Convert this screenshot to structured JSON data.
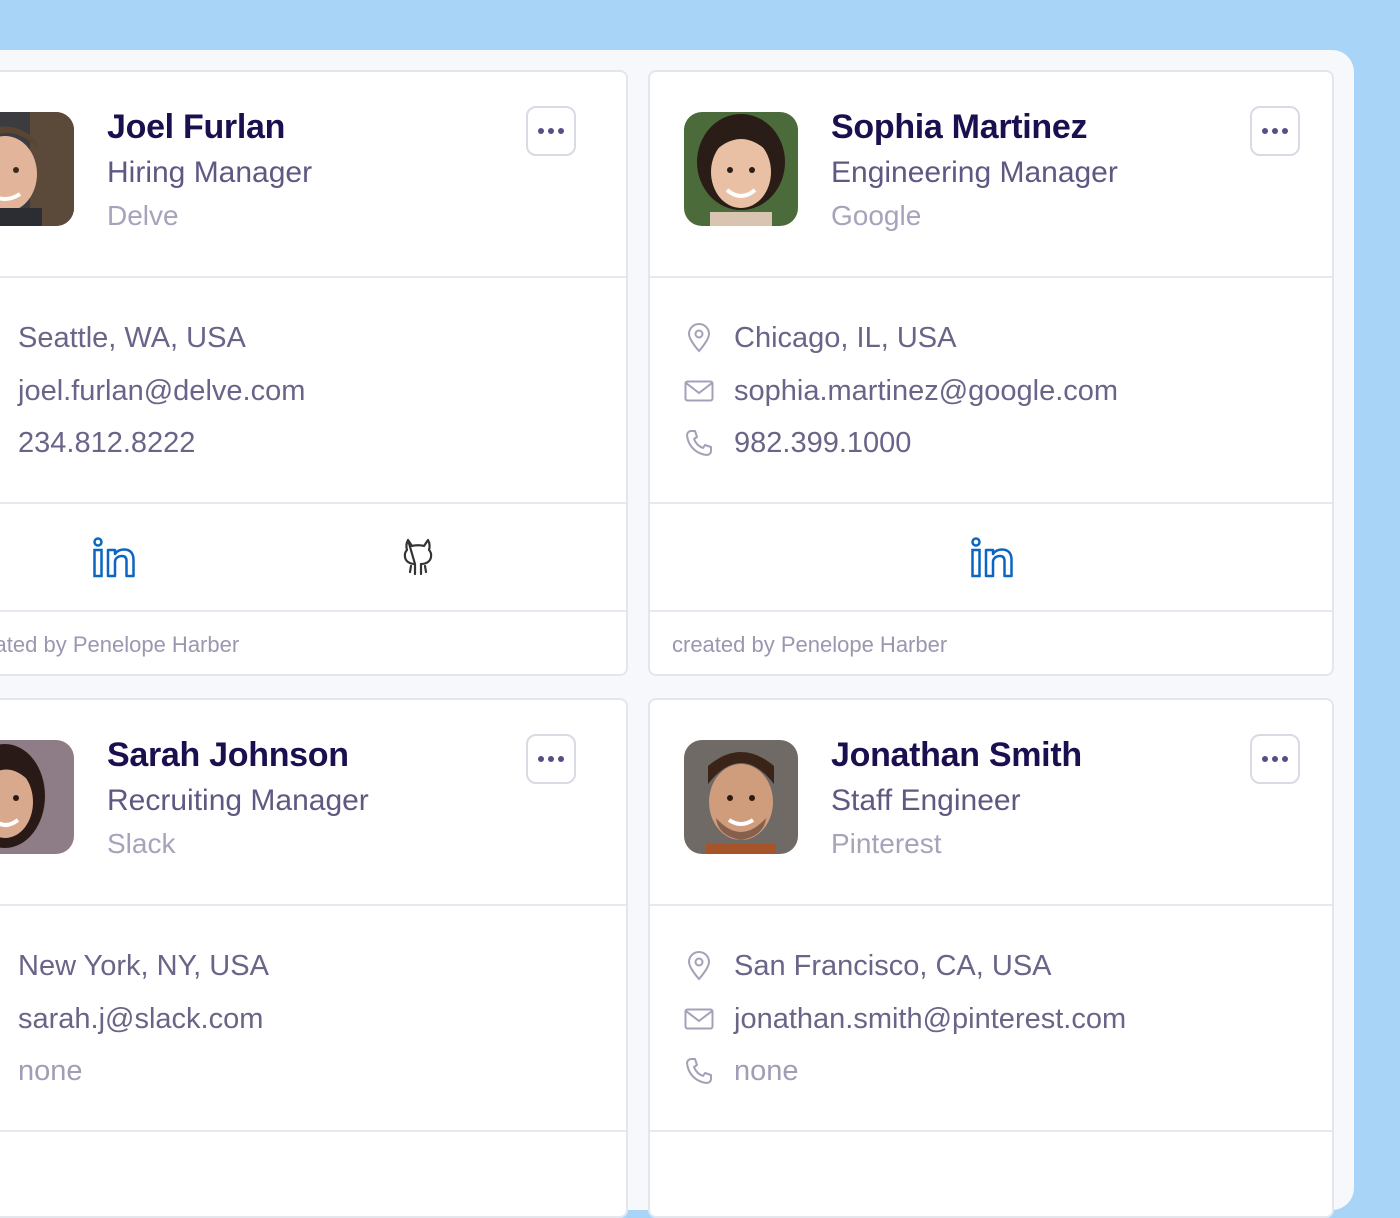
{
  "contacts": [
    {
      "name": "Joel Furlan",
      "title": "Hiring Manager",
      "company": "Delve",
      "location": "Seattle, WA, USA",
      "email": "joel.furlan@delve.com",
      "phone": "234.812.8222",
      "socials": [
        "linkedin-icon",
        "github-icon"
      ],
      "footer": "created by Penelope Harber"
    },
    {
      "name": "Sophia Martinez",
      "title": "Engineering Manager",
      "company": "Google",
      "location": "Chicago, IL, USA",
      "email": "sophia.martinez@google.com",
      "phone": "982.399.1000",
      "socials": [
        "linkedin-icon"
      ],
      "footer": "created by Penelope Harber"
    },
    {
      "name": "Sarah Johnson",
      "title": "Recruiting Manager",
      "company": "Slack",
      "location": "New York, NY, USA",
      "email": "sarah.j@slack.com",
      "phone": "none"
    },
    {
      "name": "Jonathan Smith",
      "title": "Staff Engineer",
      "company": "Pinterest",
      "location": "San Francisco, CA, USA",
      "email": "jonathan.smith@pinterest.com",
      "phone": "none"
    }
  ],
  "colors": {
    "background": "#a8d4f7",
    "name": "#1c0f4f",
    "linkedin": "#0a66c2"
  },
  "icons": {
    "menu": "more-horizontal-icon",
    "location": "map-pin-icon",
    "email": "mail-icon",
    "phone": "phone-icon"
  }
}
